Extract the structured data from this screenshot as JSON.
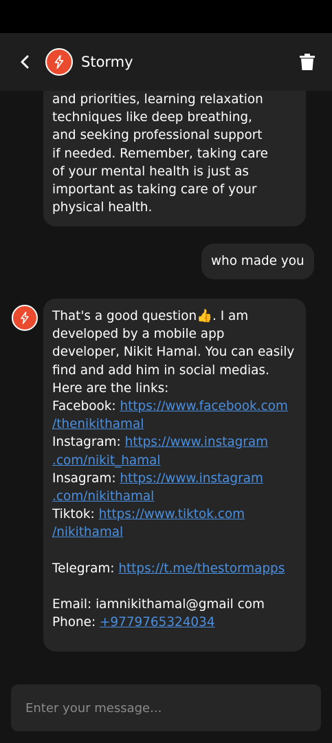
{
  "colors": {
    "background": "#141414",
    "app_bar": "#1e1e1e",
    "bubble": "#262626",
    "accent": "#ea4b2e",
    "link": "#4a90e2"
  },
  "header": {
    "title": "Stormy",
    "back_icon": "chevron-left-icon",
    "avatar_icon": "lightning-bolt-icon",
    "delete_icon": "trash-icon"
  },
  "messages": [
    {
      "sender": "bot",
      "lines": [
        "and priorities, learning relaxation",
        "techniques like deep breathing,",
        "and seeking professional support",
        "if needed. Remember, taking care",
        "of your mental health is just as",
        "important as taking care of your",
        "physical health."
      ]
    },
    {
      "sender": "user",
      "text": "who made you"
    },
    {
      "sender": "bot",
      "intro_lines": [
        "That's a good question👍. I am",
        "developed by a mobile app",
        "developer, Nikit Hamal. You can easily",
        "find and add him in social medias.",
        "Here are the links:"
      ],
      "facebook": {
        "label": "Facebook: ",
        "link_line1": "https://www.facebook.com",
        "link_line2": "/thenikithamal"
      },
      "instagram": {
        "label": "Instagram: ",
        "link_line1": "https://www.instagram",
        "link_line2": ".com/nikit_hamal"
      },
      "insagram": {
        "label": "Insagram: ",
        "link_line1": "https://www.instagram",
        "link_line2": ".com/nikithamal"
      },
      "tiktok": {
        "label": "Tiktok: ",
        "link_line1": "https://www.tiktok.com",
        "link_line2": "/nikithamal"
      },
      "telegram": {
        "label": "Telegram: ",
        "link": "https://t.me/thestormapps"
      },
      "email": "Email: iamnikithamal@gmail com",
      "phone": {
        "label": "Phone: ",
        "link": "+9779765324034"
      }
    }
  ],
  "composer": {
    "placeholder": "Enter your message..."
  }
}
